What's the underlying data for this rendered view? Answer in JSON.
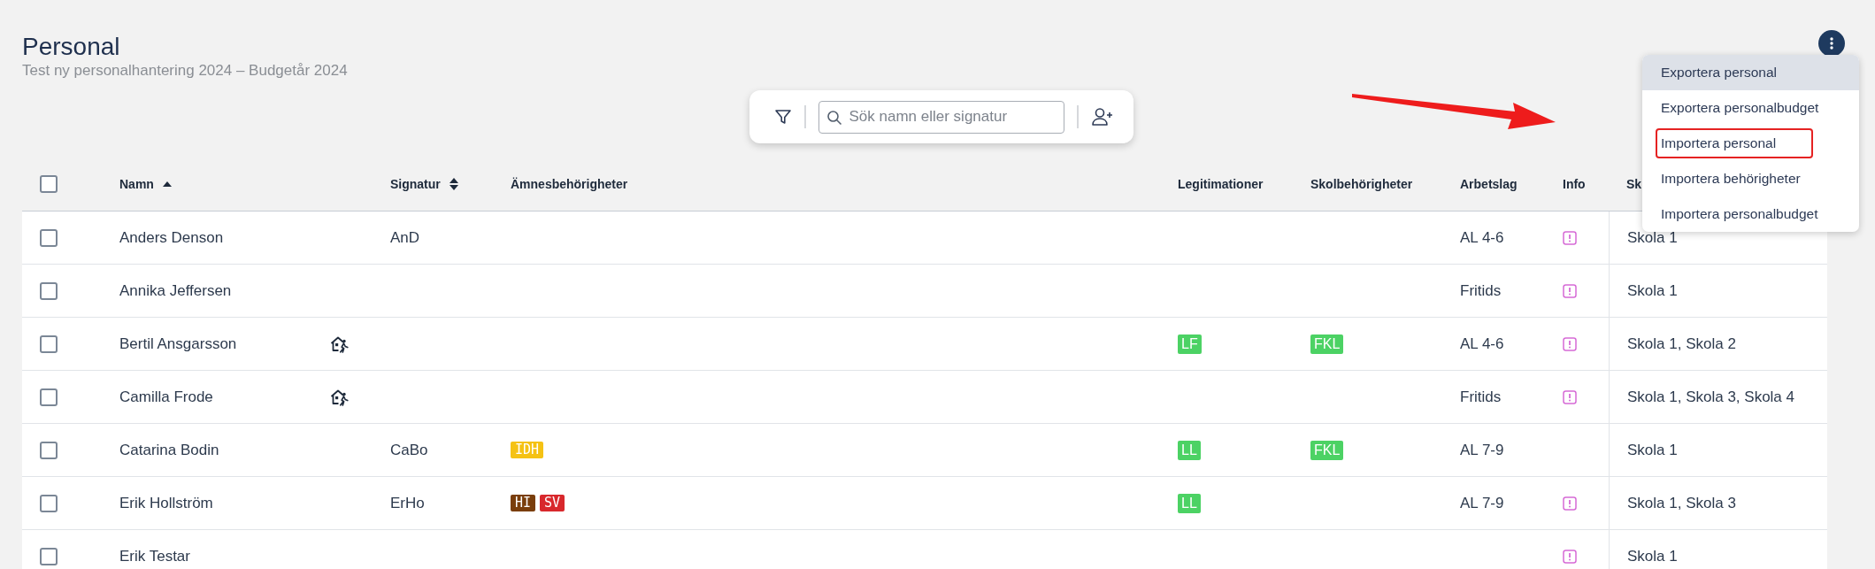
{
  "page": {
    "title": "Personal",
    "subtitle": "Test ny personalhantering 2024 – Budgetår 2024"
  },
  "toolbar": {
    "search": {
      "placeholder": "Sök namn eller signatur"
    }
  },
  "menu": {
    "open": true,
    "items": [
      {
        "label": "Exportera personal",
        "selected": true,
        "outlined": false
      },
      {
        "label": "Exportera personalbudget",
        "selected": false,
        "outlined": false
      },
      {
        "label": "Importera personal",
        "selected": false,
        "outlined": true
      },
      {
        "label": "Importera behörigheter",
        "selected": false,
        "outlined": false
      },
      {
        "label": "Importera personalbudget",
        "selected": false,
        "outlined": false
      }
    ]
  },
  "table": {
    "select_all": {
      "checked": false
    },
    "columns": [
      {
        "label": "Namn",
        "sorted": true,
        "sortable": true
      },
      {
        "label": "Signatur",
        "sorted": false,
        "sortable": true
      },
      {
        "label": "Ämnesbehörigheter",
        "sortable": false
      },
      {
        "label": "Legitimationer",
        "sortable": false
      },
      {
        "label": "Skolbehörigheter",
        "sortable": false
      },
      {
        "label": "Arbetslag",
        "sortable": false
      },
      {
        "label": "Info",
        "sortable": false
      },
      {
        "label": "Sk",
        "sortable": false
      }
    ],
    "rows": [
      {
        "checked": false,
        "name": "Anders Denson",
        "away": false,
        "signature": "AnD",
        "team": "AL 4-6",
        "info": true,
        "schools": "Skola 1"
      },
      {
        "checked": false,
        "name": "Annika Jeffersen",
        "away": false,
        "team": "Fritids",
        "info": true,
        "schools": "Skola 1"
      },
      {
        "checked": false,
        "name": "Bertil Ansgarsson",
        "away": true,
        "licenses": [
          {
            "label": "LF",
            "color": "#4cd264"
          }
        ],
        "school_qualifications": [
          {
            "label": "FKL",
            "color": "#4cd264"
          }
        ],
        "team": "AL 4-6",
        "info": true,
        "schools": "Skola 1, Skola 2"
      },
      {
        "checked": false,
        "name": "Camilla Frode",
        "away": true,
        "team": "Fritids",
        "info": true,
        "schools": "Skola 1, Skola 3, Skola 4"
      },
      {
        "checked": false,
        "name": "Catarina Bodin",
        "away": false,
        "signature": "CaBo",
        "subjects": [
          {
            "label": "IDH",
            "color": "#f5c214"
          }
        ],
        "licenses": [
          {
            "label": "LL",
            "color": "#4cd264"
          }
        ],
        "school_qualifications": [
          {
            "label": "FKL",
            "color": "#4cd264"
          }
        ],
        "team": "AL 7-9",
        "info": false,
        "schools": "Skola 1"
      },
      {
        "checked": false,
        "name": "Erik Hollström",
        "away": false,
        "signature": "ErHo",
        "subjects": [
          {
            "label": "HI",
            "color": "#7a3e0c"
          },
          {
            "label": "SV",
            "color": "#d8282c"
          }
        ],
        "licenses": [
          {
            "label": "LL",
            "color": "#4cd264"
          }
        ],
        "team": "AL 7-9",
        "info": true,
        "schools": "Skola 1, Skola 3"
      },
      {
        "checked": false,
        "name": "Erik Testar",
        "away": false,
        "info": true,
        "schools": "Skola 1"
      }
    ]
  }
}
